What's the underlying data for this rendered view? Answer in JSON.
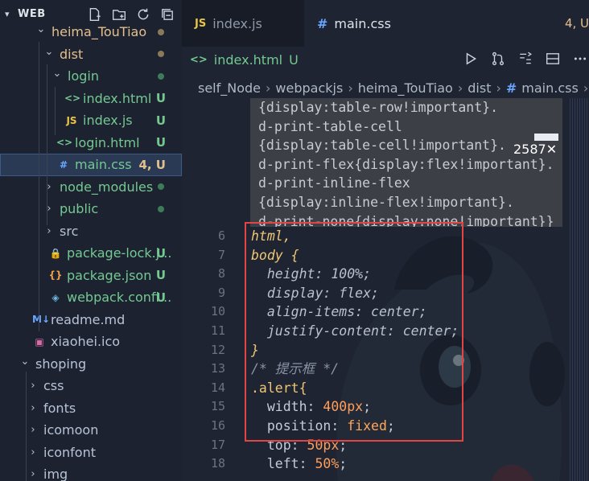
{
  "explorer": {
    "title": "WEB",
    "tree": [
      {
        "label": "heima_TouTiao",
        "type": "folder",
        "depth": 2,
        "expanded": true,
        "status": "dot-modified"
      },
      {
        "label": "dist",
        "type": "folder",
        "depth": 3,
        "expanded": true,
        "status": "dot-modified"
      },
      {
        "label": "login",
        "type": "folder",
        "depth": 4,
        "expanded": true,
        "status": "dot-untracked"
      },
      {
        "label": "index.html",
        "type": "html",
        "depth": 5,
        "status": "U"
      },
      {
        "label": "index.js",
        "type": "js",
        "depth": 5,
        "status": "U"
      },
      {
        "label": "login.html",
        "type": "html",
        "depth": 4,
        "status": "U"
      },
      {
        "label": "main.css",
        "type": "css",
        "depth": 4,
        "status": "4, U",
        "selected": true
      },
      {
        "label": "node_modules",
        "type": "folder",
        "depth": 3,
        "expanded": false,
        "status": "dot-untracked"
      },
      {
        "label": "public",
        "type": "folder",
        "depth": 3,
        "expanded": false,
        "status": "dot-untracked"
      },
      {
        "label": "src",
        "type": "folder",
        "depth": 3,
        "expanded": false,
        "status": ""
      },
      {
        "label": "package-lock.j...",
        "type": "lock",
        "depth": 3,
        "status": "U"
      },
      {
        "label": "package.json",
        "type": "json",
        "depth": 3,
        "status": "U"
      },
      {
        "label": "webpack.confi...",
        "type": "webpack",
        "depth": 3,
        "status": "U"
      },
      {
        "label": "readme.md",
        "type": "md",
        "depth": 1,
        "status": ""
      },
      {
        "label": "xiaohei.ico",
        "type": "ico",
        "depth": 1,
        "status": ""
      },
      {
        "label": "shoping",
        "type": "folder",
        "depth": 0,
        "expanded": true,
        "status": ""
      },
      {
        "label": "css",
        "type": "folder",
        "depth": 1,
        "expanded": false,
        "status": ""
      },
      {
        "label": "fonts",
        "type": "folder",
        "depth": 1,
        "expanded": false,
        "status": ""
      },
      {
        "label": "icomoon",
        "type": "folder",
        "depth": 1,
        "expanded": false,
        "status": ""
      },
      {
        "label": "iconfont",
        "type": "folder",
        "depth": 1,
        "expanded": false,
        "status": ""
      },
      {
        "label": "img",
        "type": "folder",
        "depth": 1,
        "expanded": false,
        "status": ""
      }
    ]
  },
  "tabs": [
    {
      "label": "index.js",
      "icon": "JS",
      "status": ""
    },
    {
      "label": "main.css",
      "icon": "#",
      "status": "4, U",
      "active": true
    }
  ],
  "tab2": {
    "label": "index.html",
    "icon": "<>",
    "status": "U"
  },
  "breadcrumb": [
    "self_Node",
    "webpackjs",
    "heima_TouTiao",
    "dist",
    "main.css"
  ],
  "sticky_scroll": [
    "{display:table-row!important}.",
    "d-print-table-cell",
    "{display:table-cell!important}.",
    "d-print-flex{display:flex!important}.",
    "d-print-inline-flex",
    "{display:inline-flex!important}.",
    "d-print-none{display:none!important}}"
  ],
  "badge": {
    "text": "2587✕"
  },
  "code": {
    "line_numbers": [
      "6",
      "7",
      "8",
      "9",
      "10",
      "11",
      "12",
      "13",
      "14",
      "15",
      "16",
      "17",
      "18"
    ],
    "lines": [
      [
        {
          "t": "html,",
          "c": "c-sel c-ital"
        }
      ],
      [
        {
          "t": "body {",
          "c": "c-sel c-ital"
        }
      ],
      [
        {
          "t": "  height: ",
          "c": "c-prop-dim"
        },
        {
          "t": "100%",
          "c": "c-prop-dim"
        },
        {
          "t": ";",
          "c": "c-prop-dim"
        }
      ],
      [
        {
          "t": "  display: flex;",
          "c": "c-prop-dim"
        }
      ],
      [
        {
          "t": "  align-items: center;",
          "c": "c-prop-dim"
        }
      ],
      [
        {
          "t": "  justify-content: center;",
          "c": "c-prop-dim"
        }
      ],
      [
        {
          "t": "}",
          "c": "c-sel c-ital"
        }
      ],
      [
        {
          "t": "/* 提示框 */",
          "c": "c-com"
        }
      ],
      [
        {
          "t": ".alert{",
          "c": "c-sel"
        }
      ],
      [
        {
          "t": "  width: ",
          "c": "c-prop"
        },
        {
          "t": "400px",
          "c": "c-num"
        },
        {
          "t": ";",
          "c": "c-punc"
        }
      ],
      [
        {
          "t": "  position: ",
          "c": "c-prop"
        },
        {
          "t": "fixed",
          "c": "c-val"
        },
        {
          "t": ";",
          "c": "c-punc"
        }
      ],
      [
        {
          "t": "  top: ",
          "c": "c-prop"
        },
        {
          "t": "50px",
          "c": "c-num"
        },
        {
          "t": ";",
          "c": "c-punc"
        }
      ],
      [
        {
          "t": "  left: ",
          "c": "c-prop"
        },
        {
          "t": "50%",
          "c": "c-num"
        },
        {
          "t": ";",
          "c": "c-punc"
        }
      ]
    ]
  },
  "colors": {
    "highlight_box": "#e34444",
    "untracked": "#73c991",
    "modified": "#e2c08d",
    "selector": "#f0c674",
    "number": "#ff9e5b"
  }
}
